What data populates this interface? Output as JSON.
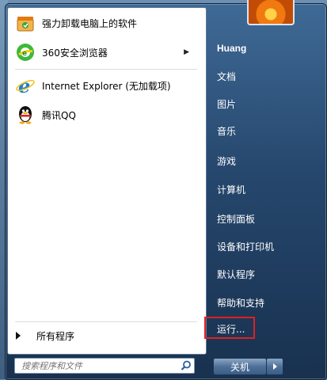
{
  "menu": {
    "pinned": [
      {
        "label": "强力卸载电脑上的软件",
        "icon": "uninstall-box-icon"
      },
      {
        "label": "360安全浏览器",
        "icon": "360-browser-icon",
        "has_submenu": true
      }
    ],
    "recent": [
      {
        "label": "Internet Explorer (无加载项)",
        "icon": "internet-explorer-icon"
      },
      {
        "label": "腾讯QQ",
        "icon": "qq-penguin-icon"
      }
    ],
    "all_programs": "所有程序",
    "search_placeholder": "搜索程序和文件"
  },
  "right": {
    "user": "Huang",
    "items": [
      "文档",
      "图片",
      "音乐",
      "游戏",
      "计算机",
      "控制面板",
      "设备和打印机",
      "默认程序",
      "帮助和支持",
      "运行..."
    ],
    "highlighted": "运行..."
  },
  "shutdown": {
    "label": "关机"
  },
  "colors": {
    "highlight_border": "#e02020",
    "menu_frame": "#26476d"
  }
}
